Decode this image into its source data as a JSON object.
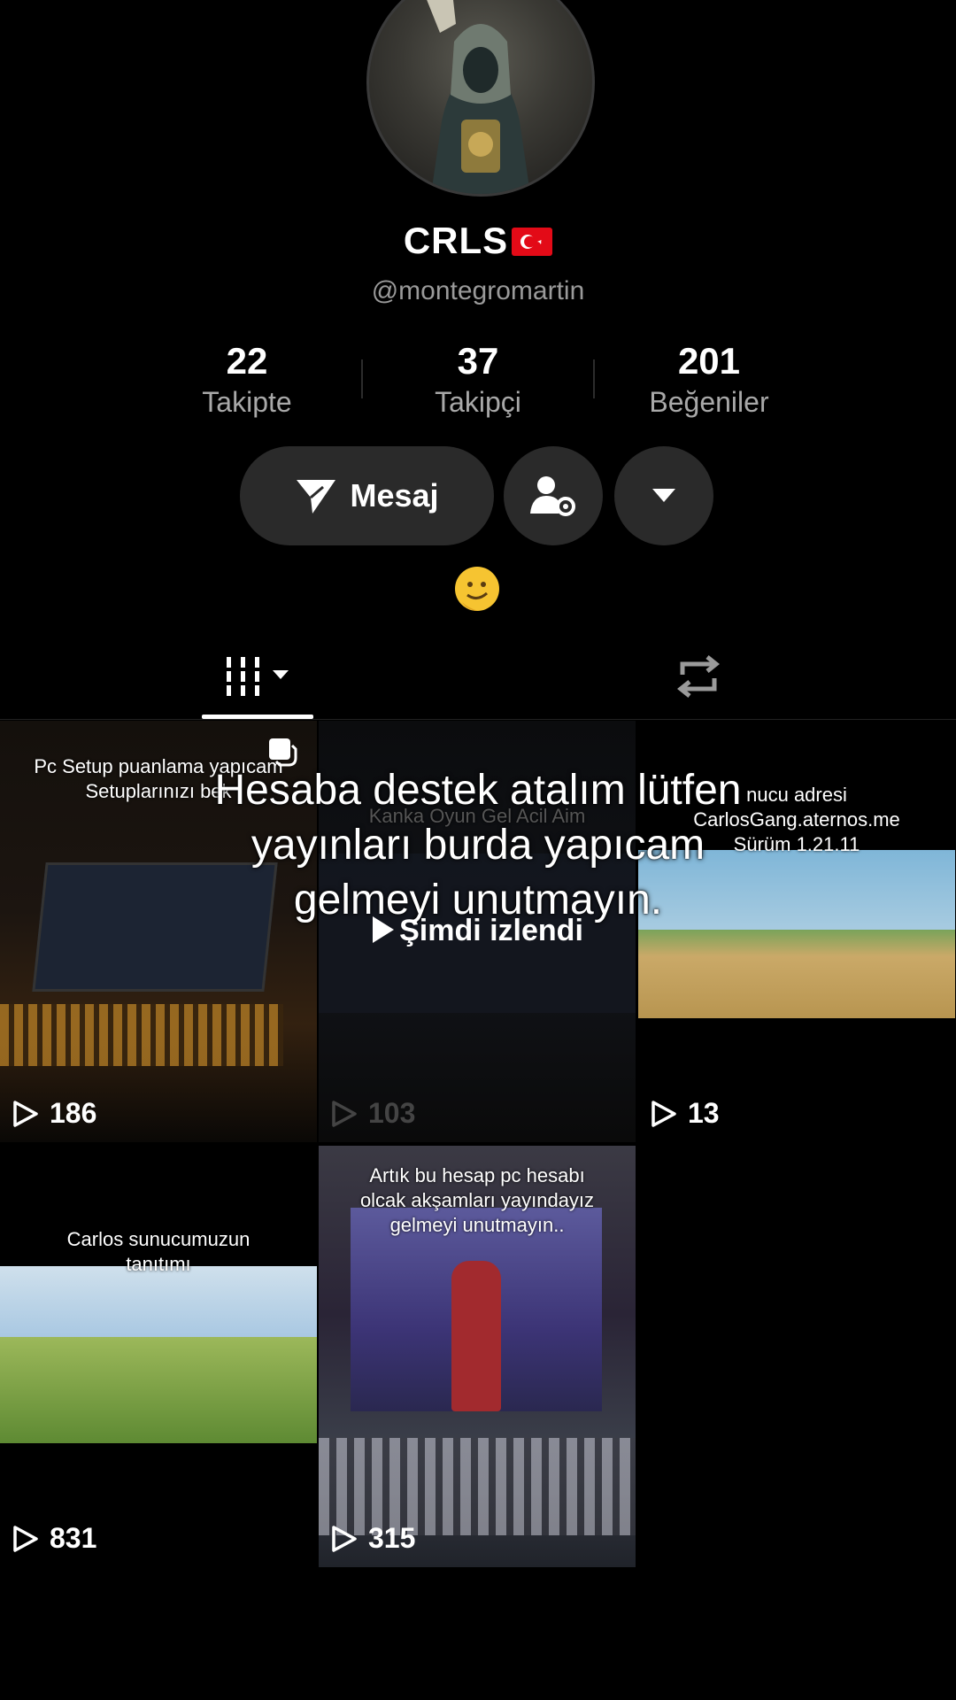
{
  "profile": {
    "display_name": "CRLS",
    "handle": "@montegromartin",
    "bio_emoji": "🫠"
  },
  "stats": [
    {
      "value": "22",
      "label": "Takipte"
    },
    {
      "value": "37",
      "label": "Takipçi"
    },
    {
      "value": "201",
      "label": "Beğeniler"
    }
  ],
  "actions": {
    "message_label": "Mesaj"
  },
  "overlay": {
    "line1": "Hesaba destek atalım lütfen",
    "line2": "yayınları burda yapıcam",
    "line3": "gelmeyi unutmayın.",
    "watched_label": "Şimdi izlendi"
  },
  "videos": [
    {
      "caption1": "Pc Setup puanlama yapıcam",
      "caption2": "Setuplarınızı bek",
      "views": "186"
    },
    {
      "caption1": "Kanka Oyun Gel Acil Aim",
      "caption2": "",
      "views": "103"
    },
    {
      "caption1": "nucu adresi",
      "caption2": "CarlosGang.aternos.me",
      "caption3": "Sürüm 1.21.11",
      "views": "13"
    },
    {
      "caption1": "Carlos sunucumuzun",
      "caption2": "tanıtımı",
      "views": "831"
    },
    {
      "caption1": "Artık bu hesap pc hesabı",
      "caption2": "olcak akşamları yayındayız",
      "caption3": "gelmeyi unutmayın..",
      "views": "315"
    }
  ],
  "colors": {
    "background": "#000000",
    "button": "#2a2a2a",
    "muted": "#a8a8a8",
    "flag_red": "#e30a17"
  }
}
